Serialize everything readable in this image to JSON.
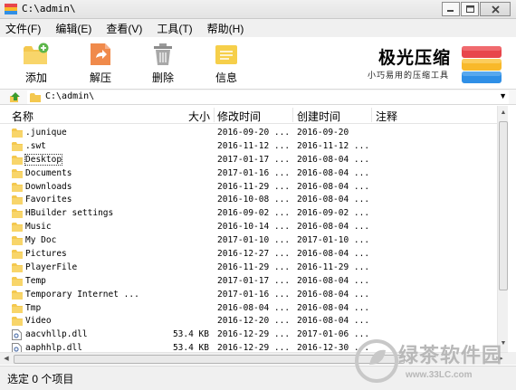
{
  "window": {
    "title": "C:\\admin\\"
  },
  "menu": [
    "文件(F)",
    "编辑(E)",
    "查看(V)",
    "工具(T)",
    "帮助(H)"
  ],
  "toolbar": {
    "add": "添加",
    "extract": "解压",
    "delete": "删除",
    "info": "信息"
  },
  "brand": {
    "title": "极光压缩",
    "subtitle": "小巧易用的压缩工具"
  },
  "address": {
    "path": "C:\\admin\\"
  },
  "columns": {
    "name": "名称",
    "size": "大小",
    "modified": "修改时间",
    "created": "创建时间",
    "comment": "注释"
  },
  "files": [
    {
      "name": ".junique",
      "size": "",
      "modified": "2016-09-20 ...",
      "created": "2016-09-20",
      "type": "folder"
    },
    {
      "name": ".swt",
      "size": "",
      "modified": "2016-11-12 ...",
      "created": "2016-11-12 ...",
      "type": "folder"
    },
    {
      "name": "Desktop",
      "size": "",
      "modified": "2017-01-17 ...",
      "created": "2016-08-04 ...",
      "type": "folder"
    },
    {
      "name": "Documents",
      "size": "",
      "modified": "2017-01-16 ...",
      "created": "2016-08-04 ...",
      "type": "folder"
    },
    {
      "name": "Downloads",
      "size": "",
      "modified": "2016-11-29 ...",
      "created": "2016-08-04 ...",
      "type": "folder"
    },
    {
      "name": "Favorites",
      "size": "",
      "modified": "2016-10-08 ...",
      "created": "2016-08-04 ...",
      "type": "folder"
    },
    {
      "name": "HBuilder settings",
      "size": "",
      "modified": "2016-09-02 ...",
      "created": "2016-09-02 ...",
      "type": "folder"
    },
    {
      "name": "Music",
      "size": "",
      "modified": "2016-10-14 ...",
      "created": "2016-08-04 ...",
      "type": "folder"
    },
    {
      "name": "My Doc",
      "size": "",
      "modified": "2017-01-10 ...",
      "created": "2017-01-10 ...",
      "type": "folder"
    },
    {
      "name": "Pictures",
      "size": "",
      "modified": "2016-12-27 ...",
      "created": "2016-08-04 ...",
      "type": "folder"
    },
    {
      "name": "PlayerFile",
      "size": "",
      "modified": "2016-11-29 ...",
      "created": "2016-11-29 ...",
      "type": "folder"
    },
    {
      "name": "Temp",
      "size": "",
      "modified": "2017-01-17 ...",
      "created": "2016-08-04 ...",
      "type": "folder"
    },
    {
      "name": "Temporary Internet ...",
      "size": "",
      "modified": "2017-01-16 ...",
      "created": "2016-08-04 ...",
      "type": "folder"
    },
    {
      "name": "Tmp",
      "size": "",
      "modified": "2016-08-04 ...",
      "created": "2016-08-04 ...",
      "type": "folder"
    },
    {
      "name": "Video",
      "size": "",
      "modified": "2016-12-20 ...",
      "created": "2016-08-04 ...",
      "type": "folder"
    },
    {
      "name": "aacvhllp.dll",
      "size": "53.4 KB",
      "modified": "2016-12-29 ...",
      "created": "2017-01-06 ...",
      "type": "file"
    },
    {
      "name": "aaphhlp.dll",
      "size": "53.4 KB",
      "modified": "2016-12-29 ...",
      "created": "2016-12-30 ...",
      "type": "file"
    }
  ],
  "focused_item": "Desktop",
  "status": "选定 0 个项目",
  "watermark": {
    "text": "绿茶软件园",
    "url": "www.33LC.com"
  },
  "colors": {
    "folder": "#f4c84f",
    "accent_green": "#5db64a",
    "logo_red": "#e8464b",
    "logo_yellow": "#f8b92a",
    "logo_blue": "#2f8fe6"
  }
}
